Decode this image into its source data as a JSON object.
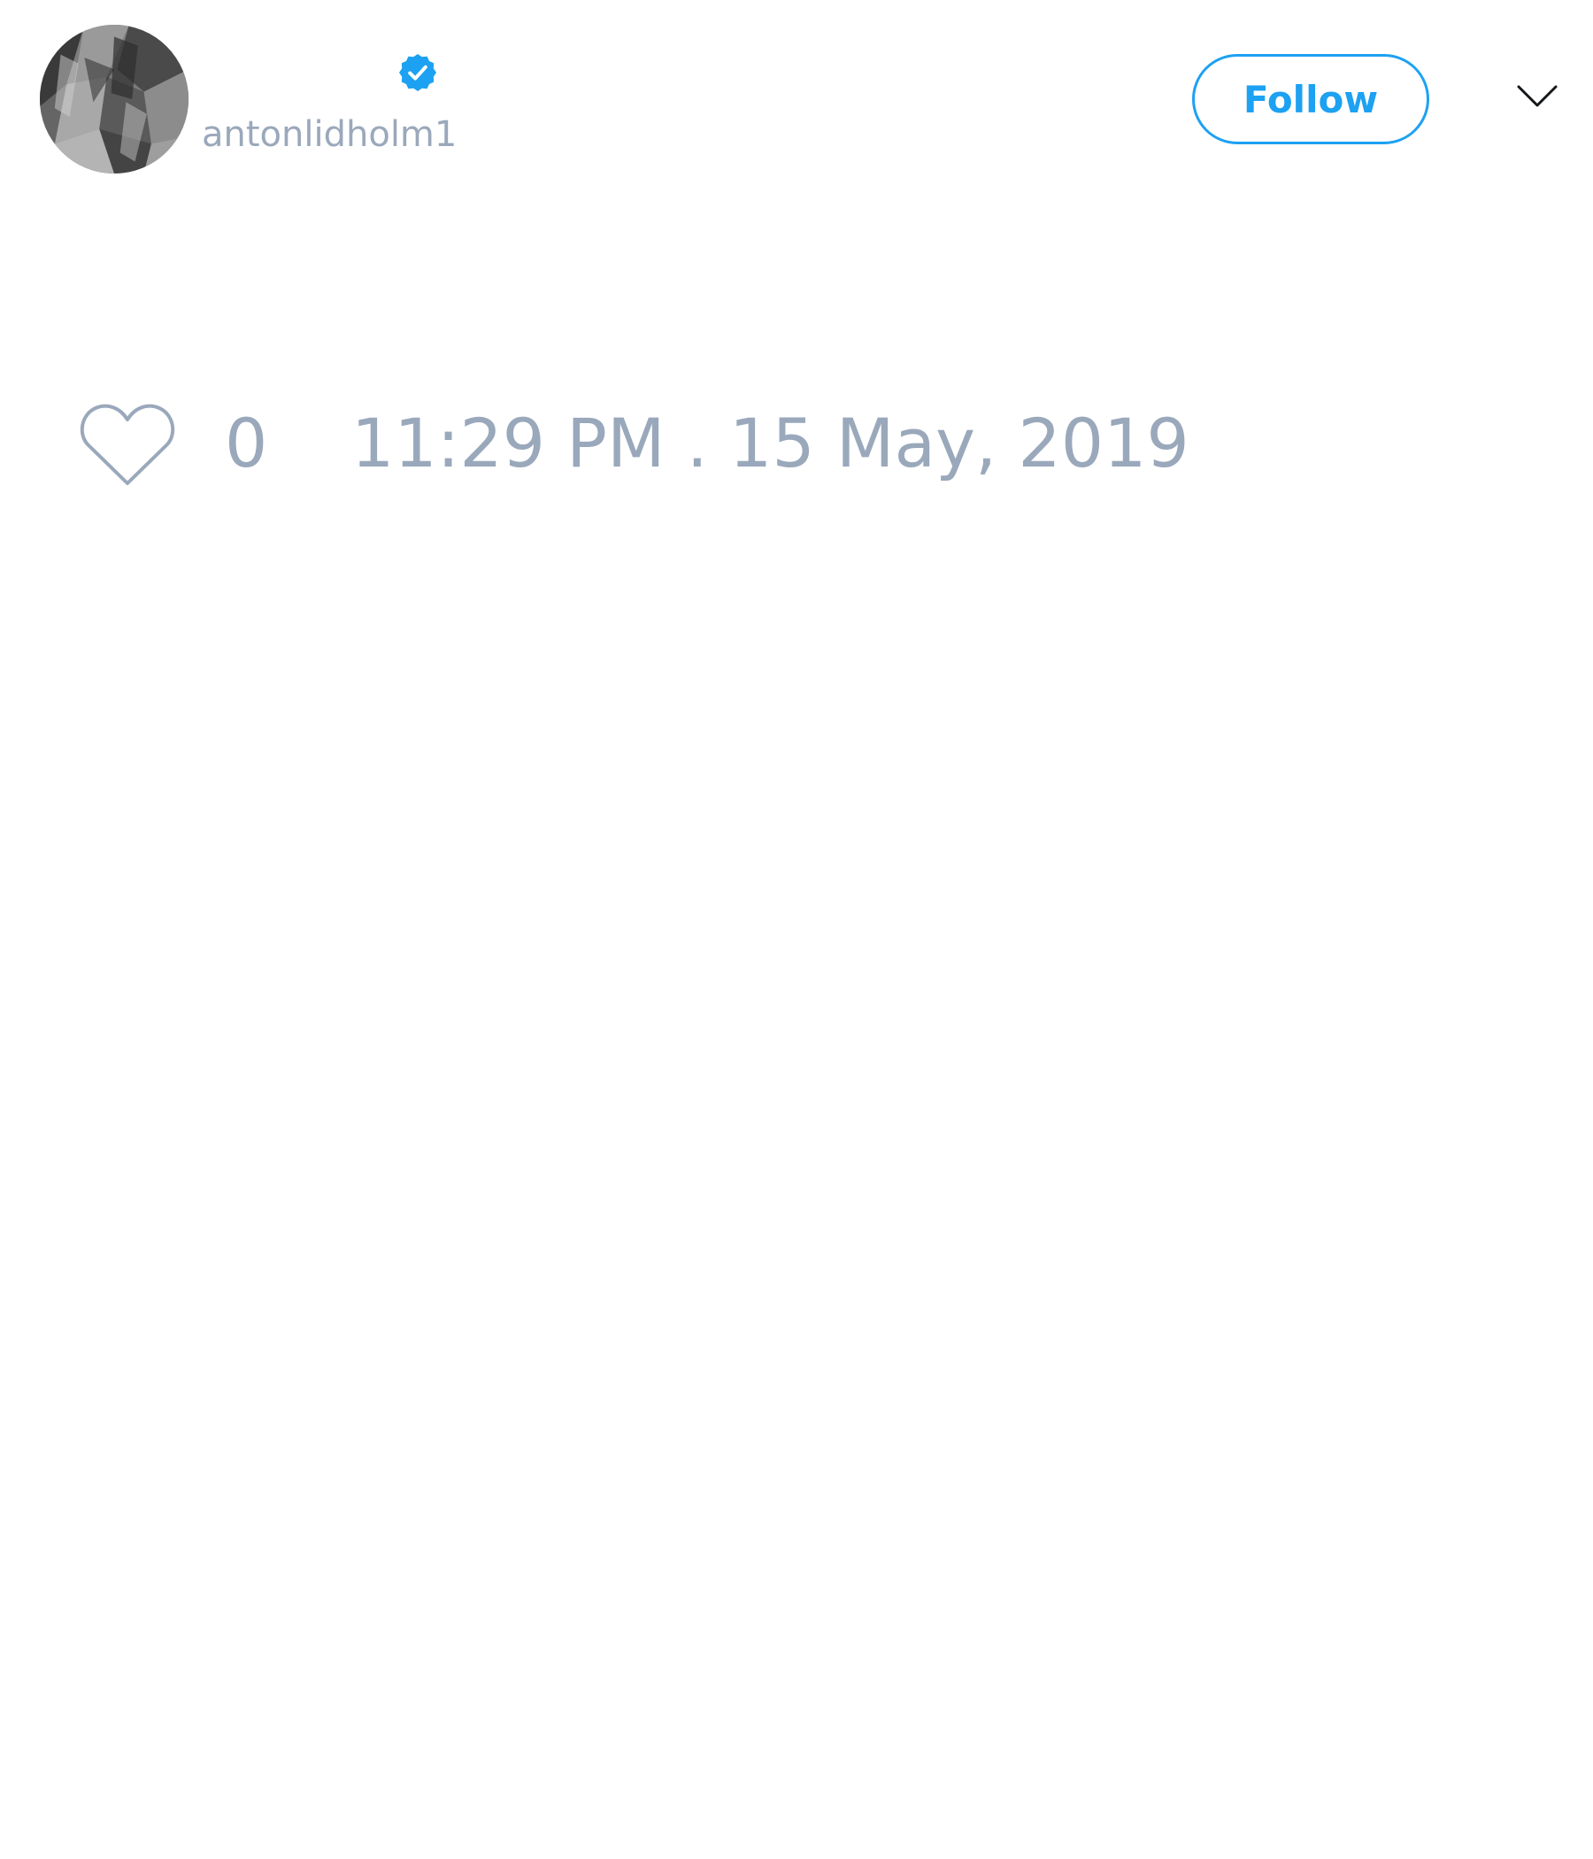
{
  "tweet": {
    "author": {
      "handle": "antonlidholm1",
      "verified": true,
      "avatar_icon": "profile-photo"
    },
    "follow_label": "Follow",
    "menu_icon": "chevron-down-icon",
    "likes": {
      "icon": "heart-icon",
      "count": "0"
    },
    "timestamp": "11:29 PM . 15 May, 2019"
  },
  "colors": {
    "accent": "#1da1f2",
    "muted_text": "#9aa8bb",
    "background": "#ffffff"
  }
}
